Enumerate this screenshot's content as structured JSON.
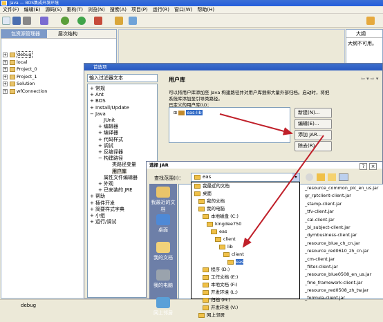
{
  "app": {
    "title": "Java — BOS集成开发环境",
    "menu": [
      "文件(F)",
      "编辑(E)",
      "源码(S)",
      "重构(T)",
      "浏览(N)",
      "搜索(A)",
      "项目(P)",
      "运行(R)",
      "窗口(W)",
      "帮助(H)"
    ]
  },
  "left_panel": {
    "tabs": [
      "包资源管理器",
      "层次结构"
    ],
    "items": [
      "debug",
      "local",
      "Project_0",
      "Project_1",
      "Solution",
      "wfConnection"
    ]
  },
  "outline": {
    "tab": "大纲",
    "message": "大纲不可用。"
  },
  "status": {
    "text": "debug"
  },
  "prefs": {
    "title": "首选项",
    "filter": "输入过滤器文本",
    "nav": [
      {
        "label": "常规",
        "depth": 0,
        "expander": "+"
      },
      {
        "label": "Ant",
        "depth": 0,
        "expander": "+"
      },
      {
        "label": "BOS",
        "depth": 0,
        "expander": "+"
      },
      {
        "label": "Install/Update",
        "depth": 0,
        "expander": "+"
      },
      {
        "label": "Java",
        "depth": 0,
        "expander": "−"
      },
      {
        "label": "JUnit",
        "depth": 1,
        "expander": ""
      },
      {
        "label": "编辑器",
        "depth": 1,
        "expander": "+"
      },
      {
        "label": "编译器",
        "depth": 1,
        "expander": "+"
      },
      {
        "label": "代码样式",
        "depth": 1,
        "expander": "+"
      },
      {
        "label": "调试",
        "depth": 1,
        "expander": "+"
      },
      {
        "label": "反编译器",
        "depth": 1,
        "expander": "+"
      },
      {
        "label": "构建路径",
        "depth": 1,
        "expander": "−"
      },
      {
        "label": "类路径变量",
        "depth": 2,
        "expander": ""
      },
      {
        "label": "用户库",
        "depth": 2,
        "expander": ""
      },
      {
        "label": "属性文件编辑器",
        "depth": 1,
        "expander": ""
      },
      {
        "label": "外观",
        "depth": 1,
        "expander": "+"
      },
      {
        "label": "已安装的 JRE",
        "depth": 1,
        "expander": "+"
      },
      {
        "label": "帮助",
        "depth": 0,
        "expander": "+"
      },
      {
        "label": "插件开发",
        "depth": 0,
        "expander": "+"
      },
      {
        "label": "简要样式字典",
        "depth": 0,
        "expander": "+"
      },
      {
        "label": "小组",
        "depth": 0,
        "expander": "+"
      },
      {
        "label": "运行/调试",
        "depth": 0,
        "expander": "+"
      }
    ],
    "page_title": "用户库",
    "desc1": "可以将用户库添加至 Java 构建路径并对用户库捆绑大量外部归档。启动时，将把",
    "desc2": "系统库添加至引导类路径。",
    "defined_label": "已定义的用户库(U)：",
    "lib": "eas-lib",
    "buttons": [
      "新建(N)...",
      "编辑(E)...",
      "添加 JAR...",
      "除去(R)"
    ]
  },
  "jar": {
    "title": "选择 JAR",
    "lookin_label": "查找范围(I)：",
    "lookin_value": "eas",
    "sidebar": [
      "我最近的文档",
      "桌面",
      "我的文档",
      "我的电脑",
      "网上邻居"
    ],
    "tree": [
      {
        "label": "我最近的文档",
        "indent": 0
      },
      {
        "label": "桌面",
        "indent": 0
      },
      {
        "label": "我的文档",
        "indent": 1
      },
      {
        "label": "我的电脑",
        "indent": 1
      },
      {
        "label": "本地磁盘 (C:)",
        "indent": 2
      },
      {
        "label": "kingdee750",
        "indent": 3
      },
      {
        "label": "eas",
        "indent": 4
      },
      {
        "label": "client",
        "indent": 5
      },
      {
        "label": "lib",
        "indent": 6
      },
      {
        "label": "client",
        "indent": 7
      },
      {
        "label": "eas",
        "indent": 8
      },
      {
        "label": "程序 (D:)",
        "indent": 2
      },
      {
        "label": "工作文档 (E:)",
        "indent": 2
      },
      {
        "label": "本地文档 (F:)",
        "indent": 2
      },
      {
        "label": "开发环境 (L:)",
        "indent": 2
      },
      {
        "label": "归档 (M:)",
        "indent": 2
      },
      {
        "label": "开发环境 (V:)",
        "indent": 2
      },
      {
        "label": "网上邻居",
        "indent": 1
      }
    ],
    "files": [
      "_resource_common_pic_en_us.jar",
      "gr_rptclient-client.jar",
      "_stamp-client.jar",
      "_tfv-client.jar",
      "_cal-client.jar",
      "_bi_subject-client.jar",
      "_dymbusiness-client.jar",
      "_resource_blue_ch_cn.jar",
      "_resource_red0610_zh_cn.jar",
      "_cm-client.jar",
      "_filter-client.jar",
      "_resource_blue0508_en_us.jar",
      "_fme_framework-client.jar",
      "_resource_red0508_zh_tw.jar",
      "_formula-client.jar"
    ]
  },
  "colors": {
    "arrow": "#c0202a",
    "selection": "#316ac5",
    "titlebar": "#2858c2"
  }
}
